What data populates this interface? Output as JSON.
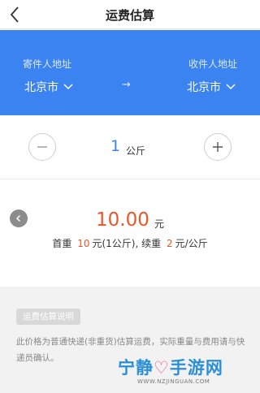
{
  "nav": {
    "title": "运费估算"
  },
  "route": {
    "from_label": "寄件人地址",
    "from_city": "北京市",
    "to_label": "收件人地址",
    "to_city": "北京市",
    "arrow": "→"
  },
  "weight": {
    "value": "1",
    "unit": "公斤"
  },
  "result": {
    "price": "10.00",
    "price_unit": "元",
    "first_label": "首重",
    "first_value": "10",
    "first_suffix": "元(1公斤),",
    "cont_label": "续重",
    "cont_value": "2",
    "cont_suffix": "元/公斤"
  },
  "notes": {
    "tag": "运费估算说明",
    "text": "此价格为普通快递(非重货)估算运费，实际重量与费用请与快递员确认。"
  },
  "watermark": {
    "line1_a": "宁静",
    "line1_b": "手游网",
    "line2": "WWW.NZJINGUAN.COM"
  },
  "colors": {
    "accent": "#3b83f0",
    "price": "#e8562a",
    "notes_bg": "#f2f2f2"
  }
}
